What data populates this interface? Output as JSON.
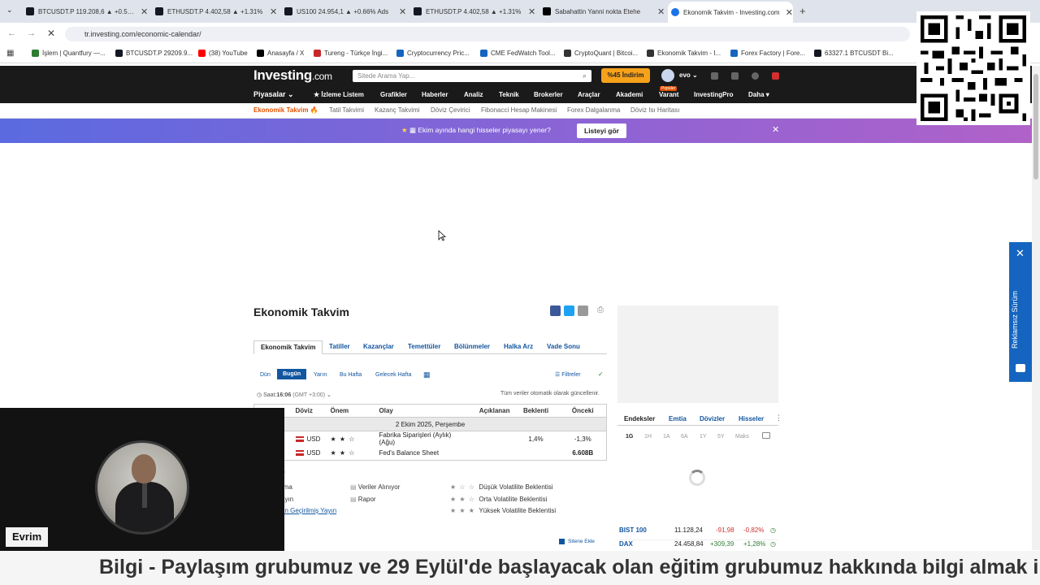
{
  "browser": {
    "tabs": [
      {
        "title": "BTCUSDT.P 119.208,6 ▲ +0.55%",
        "color": "#131722"
      },
      {
        "title": "ETHUSDT.P 4.402,58 ▲ +1.31%",
        "color": "#131722"
      },
      {
        "title": "US100 24.954,1 ▲ +0.66% Ads",
        "color": "#131722"
      },
      {
        "title": "ETHUSDT.P 4.402,58 ▲ +1.31%",
        "color": "#131722"
      },
      {
        "title": "Sabahattin Yanni nokta Etehe",
        "color": "#000000"
      },
      {
        "title": "Ekonomik Takvim - Investing.com",
        "color": "#1a73e8"
      }
    ],
    "url": "tr.investing.com/economic-calendar/",
    "bookmarks": [
      {
        "label": "İşlem | Quantfury —...",
        "color": "#2e7d32"
      },
      {
        "label": "BTCUSDT.P 29209.9...",
        "color": "#131722"
      },
      {
        "label": "(38) YouTube",
        "color": "#ff0000"
      },
      {
        "label": "Anasayfa / X",
        "color": "#000000"
      },
      {
        "label": "Tureng - Türkçe İngi...",
        "color": "#c62828"
      },
      {
        "label": "Cryptocurrency Pric...",
        "color": "#1565c0"
      },
      {
        "label": "CME FedWatch Tool...",
        "color": "#1565c0"
      },
      {
        "label": "CryptoQuant | Bitcoi...",
        "color": "#333333"
      },
      {
        "label": "Ekonomik Takvim - I...",
        "color": "#333333"
      },
      {
        "label": "Forex Factory | Fore...",
        "color": "#1565c0"
      },
      {
        "label": "63327.1 BTCUSDT Bi...",
        "color": "#131722"
      }
    ]
  },
  "site": {
    "logo": "Investing",
    "logo_suffix": ".com",
    "search_placeholder": "Sitede Arama Yap...",
    "promo": "%45 İndirim",
    "user": "evo",
    "nav": [
      "Piyasalar",
      "İzleme Listem",
      "Grafikler",
      "Haberler",
      "Analiz",
      "Teknik",
      "Brokerler",
      "Araçlar",
      "Akademi",
      "Varant",
      "InvestingPro",
      "Daha"
    ],
    "nav_badge": "Popüler",
    "subnav": [
      "Ekonomik Takvim",
      "Tatil Takvimi",
      "Kazanç Takvimi",
      "Döviz Çevirici",
      "Fibonacci Hesap Makinesi",
      "Forex Dalgalanma",
      "Döviz Isı Haritası"
    ],
    "banner_text": "Ekim ayında hangi hisseler piyasayı yener?",
    "banner_button": "Listeyi gör"
  },
  "calendar": {
    "title": "Ekonomik Takvim",
    "tabs": [
      "Ekonomik Takvim",
      "Tatiller",
      "Kazançlar",
      "Temettüler",
      "Bölünmeler",
      "Halka Arz",
      "Vade Sonu"
    ],
    "day_buttons": [
      "Dün",
      "Bugün",
      "Yarın",
      "Bu Hafta",
      "Gelecek Hafta"
    ],
    "filters": "Filtreler",
    "auto_update": "Tüm veriler otomatik olarak güncellenir.",
    "time_label": "Saat:",
    "time_value": "16:06",
    "timezone": "(GMT +3:00)",
    "columns": [
      "Döviz",
      "Önem",
      "Olay",
      "Açıklanan",
      "Beklenti",
      "Önceki"
    ],
    "date_row": "2 Ekim 2025, Perşembe",
    "rows": [
      {
        "currency": "USD",
        "stars": "★ ★ ☆",
        "event": "Fabrika Siparişleri (Aylık) (Ağu)",
        "actual": "",
        "forecast": "1,4%",
        "previous": "-1,3%"
      },
      {
        "currency": "USD",
        "stars": "★ ★ ☆",
        "event": "Fed's Balance Sheet",
        "actual": "",
        "forecast": "",
        "previous": "6.608B"
      }
    ],
    "legend_title": "ar",
    "legend_left": [
      "rma",
      "ayın",
      "an Geçirilmiş Yayın"
    ],
    "legend_mid": [
      "Veriler Alınıyor",
      "Rapor"
    ],
    "legend_right": [
      "Düşük Volatilite Beklentisi",
      "Orta Volatilite Beklentisi",
      "Yüksek Volatilite Beklentisi"
    ],
    "legend_stars": [
      "★ ☆ ☆",
      "★ ★ ☆",
      "★ ★ ★"
    ],
    "add_site": "Sitene Ekle"
  },
  "right_panel": {
    "tabs": [
      "Endeksler",
      "Emtia",
      "Dövizler",
      "Hisseler"
    ],
    "periods": [
      "1G",
      "1H",
      "1A",
      "6A",
      "1Y",
      "5Y",
      "Maks"
    ],
    "quotes": [
      {
        "name": "BIST 100",
        "value": "11.128,24",
        "change": "-91,98",
        "pct": "-0,82%",
        "color": "#d32f2f"
      },
      {
        "name": "DAX",
        "value": "24.458,84",
        "change": "+309,39",
        "pct": "+1,28%",
        "color": "#2e7d32"
      }
    ]
  },
  "side_tab": "Reklamsız Sürüm",
  "webcam": {
    "name": "Evrim"
  },
  "ticker": "Bilgi - Paylaşım grubumuz ve 29 Eylül'de başlayacak olan eğitim grubumuz hakkında bilgi almak i"
}
